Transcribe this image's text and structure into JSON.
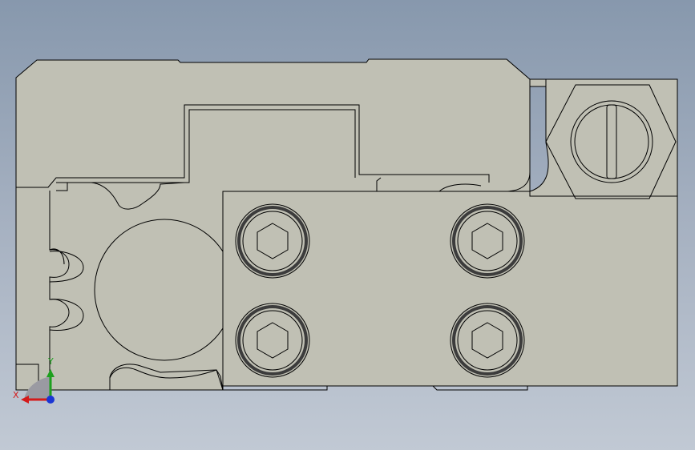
{
  "triad": {
    "x_label": "X",
    "y_label": "Y",
    "x_color": "#d41a1a",
    "y_color": "#1ea01e",
    "z_color": "#1a35d4"
  },
  "model": {
    "face_color": "#c0c0b4",
    "edge_color": "#000000",
    "socket_cap_screws": 4,
    "slotted_hex_plug": 1
  },
  "colors": {
    "background_top": "#8798ad",
    "background_bottom": "#c1c9d4"
  }
}
